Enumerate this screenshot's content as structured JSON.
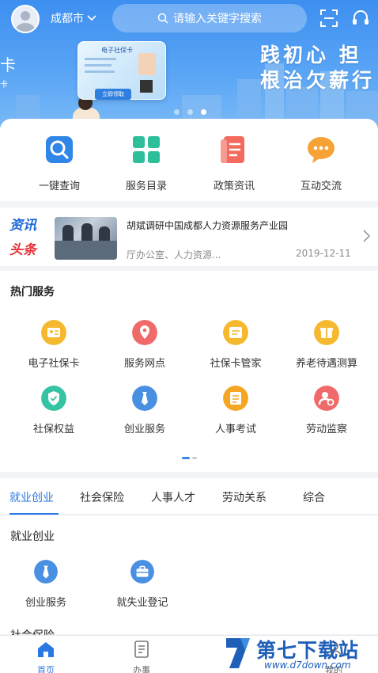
{
  "header": {
    "city": "成都市",
    "search_placeholder": "请输入关键字搜索"
  },
  "banner": {
    "slogan_line1": "践初心  担",
    "slogan_line2": "根治欠薪行",
    "card_title": "电子社保卡",
    "card_button": "立即领取",
    "edge_text": "卡",
    "edge_text_small": "卡",
    "active_slide": 3,
    "slide_count": 3
  },
  "quick_actions": [
    {
      "label": "一键查询",
      "icon": "search-icon",
      "color": "#2f86e8"
    },
    {
      "label": "服务目录",
      "icon": "grid-icon",
      "color": "#2cbf9a"
    },
    {
      "label": "政策资讯",
      "icon": "document-icon",
      "color": "#f36b5f"
    },
    {
      "label": "互动交流",
      "icon": "chat-icon",
      "color": "#f7a234"
    }
  ],
  "news": {
    "tag_line1": "资讯",
    "tag_line2": "头条",
    "title": "胡斌调研中国成都人力资源服务产业园",
    "source": "厅办公室、人力资源...",
    "date": "2019-12-11"
  },
  "hot_services": {
    "title": "热门服务",
    "items": [
      {
        "label": "电子社保卡",
        "icon": "id-card-icon",
        "color": "#f5b82e"
      },
      {
        "label": "服务网点",
        "icon": "location-pin-icon",
        "color": "#f06a6a"
      },
      {
        "label": "社保卡管家",
        "icon": "card-manager-icon",
        "color": "#f5b82e"
      },
      {
        "label": "养老待遇测算",
        "icon": "gift-box-icon",
        "color": "#f5b82e"
      },
      {
        "label": "社保权益",
        "icon": "shield-icon",
        "color": "#35c3a3"
      },
      {
        "label": "创业服务",
        "icon": "tie-icon",
        "color": "#4a90e2"
      },
      {
        "label": "人事考试",
        "icon": "exam-icon",
        "color": "#f5a623"
      },
      {
        "label": "劳动监察",
        "icon": "inspector-icon",
        "color": "#f06a6a"
      }
    ]
  },
  "tabs": [
    {
      "label": "就业创业",
      "active": true
    },
    {
      "label": "社会保险",
      "active": false
    },
    {
      "label": "人事人才",
      "active": false
    },
    {
      "label": "劳动关系",
      "active": false
    },
    {
      "label": "综合",
      "active": false
    }
  ],
  "category": {
    "title": "就业创业",
    "items": [
      {
        "label": "创业服务",
        "icon": "tie-icon"
      },
      {
        "label": "就失业登记",
        "icon": "briefcase-icon"
      }
    ],
    "next_title": "社会保险"
  },
  "bottom_nav": [
    {
      "label": "首页",
      "icon": "home-icon",
      "active": true
    },
    {
      "label": "办事",
      "icon": "task-icon",
      "active": false
    },
    {
      "label": "",
      "icon": "blank",
      "active": false
    },
    {
      "label": "我的",
      "icon": "user-icon",
      "active": false
    }
  ],
  "watermark": {
    "text": "第七下载站",
    "url": "www.d7down.com"
  }
}
